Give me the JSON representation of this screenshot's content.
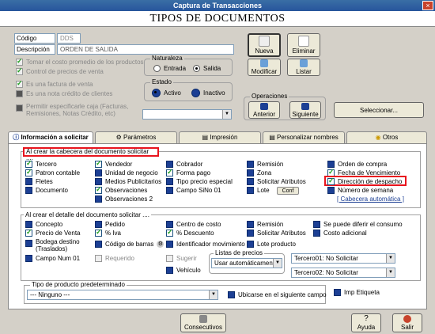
{
  "window": {
    "title": "Captura de Transacciones",
    "close": "×"
  },
  "header": {
    "title": "TIPOS DE DOCUMENTOS"
  },
  "form": {
    "codigo_label": "Código",
    "codigo_value": "DDS",
    "descripcion_label": "Descripción",
    "descripcion_value": "ORDEN DE SALIDA",
    "chk_costo": "Tomar el costo promedio de los productos",
    "chk_control": "Control de precios de venta",
    "chk_factura": "Es una factura de venta",
    "chk_nota": "Es una nota crédito de clientes",
    "chk_permitir": "Permitir especificarle caja (Facturas, Remisiones, Notas Crédito, etc)"
  },
  "naturaleza": {
    "title": "Naturaleza",
    "entrada": "Entrada",
    "salida": "Salida"
  },
  "estado": {
    "title": "Estado",
    "activo": "Activo",
    "inactivo": "Inactivo"
  },
  "buttons": {
    "nueva": "Nueva",
    "eliminar": "Eliminar",
    "modificar": "Modificar",
    "listar": "Listar",
    "seleccionar": "Seleccionar..."
  },
  "operaciones": {
    "title": "Operaciones",
    "anterior": "Anterior",
    "siguiente": "Siguiente"
  },
  "tabs": [
    "Información a solicitar",
    "Parámetros",
    "Impresión",
    "Personalizar nombres",
    "Otros"
  ],
  "cabecera": {
    "title": "Al crear la cabecera del documento solicitar ....",
    "col1": [
      "Tercero",
      "Patron contable",
      "Fletes",
      "Documento"
    ],
    "col2": [
      "Vendedor",
      "Unidad de negocio",
      "Medios Publicitarios",
      "Observaciones",
      "Observaciones 2"
    ],
    "col3": [
      "Cobrador",
      "Forma pago",
      "Tipo precio especial",
      "Campo SiNo 01"
    ],
    "col4": [
      "Remisión",
      "Zona",
      "Solicitar Atributos",
      "Lote"
    ],
    "col4_button": "Conf",
    "col5": [
      "Orden de compra",
      "Fecha de Vencimiento",
      "Dirección de despacho",
      "Número de semana"
    ],
    "col5_link": "[ Cabecera automática ]"
  },
  "detalle": {
    "title": "Al crear  el detalle del documento solicitar ....",
    "col1": [
      "Concepto",
      "Precio de Venta",
      "Bodega destino (Traslados)",
      "Campo Num 01"
    ],
    "col2": [
      "Pedido",
      "% Iva",
      "Código de barras",
      "Requerido"
    ],
    "col3": [
      "Centro de costo",
      "% Descuento",
      "Identificador movimiento",
      "Sugerir",
      "Vehículo"
    ],
    "col4": [
      "Remisión",
      "Solicitar Atributos",
      "Lote producto"
    ],
    "col5": [
      "Se puede diferir el consumo",
      "Costo adicional"
    ],
    "listas_title": "Listas de precios",
    "listas_value": "Usar automáticamente",
    "tercero01": "Tercero01: No Solicitar",
    "tercero02": "Tercero02: No Solicitar"
  },
  "tipo_producto": {
    "title": "Tipo de producto predeterminado",
    "value": "--- Ninguno ---",
    "ubicarse": "Ubicarse en el siguiente campo",
    "imp": "Imp Etiqueta"
  },
  "bottom": {
    "consecutivos": "Consecutivos",
    "ayuda": "Ayuda",
    "salir": "Salir"
  },
  "colors": {
    "title_bar": "#27559c",
    "highlight": "#e8141d",
    "check_dark": "#1c3f94"
  }
}
